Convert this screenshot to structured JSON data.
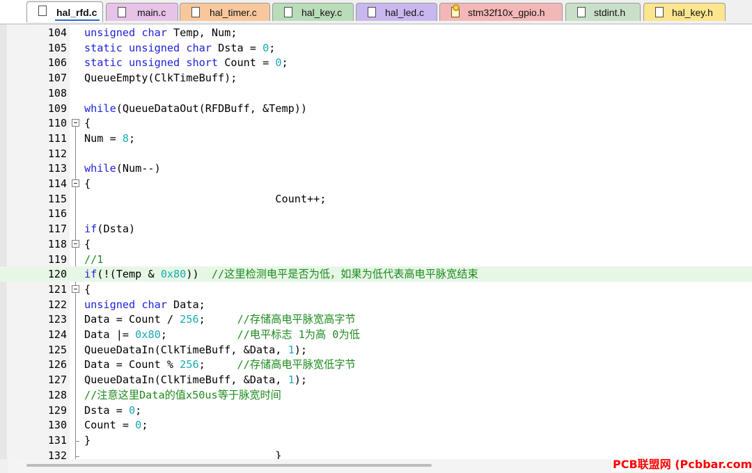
{
  "tabs": [
    {
      "label": "hal_rfd.c",
      "active": true,
      "color": "#ffffff"
    },
    {
      "label": "main.c",
      "active": false,
      "color": "#e7c3e7"
    },
    {
      "label": "hal_timer.c",
      "active": false,
      "color": "#f8c89c"
    },
    {
      "label": "hal_key.c",
      "active": false,
      "color": "#b9dcb9"
    },
    {
      "label": "hal_led.c",
      "active": false,
      "color": "#c9b8ef"
    },
    {
      "label": "stm32f10x_gpio.h",
      "active": false,
      "color": "#f4b7b7"
    },
    {
      "label": "stdint.h",
      "active": false,
      "color": "#c9dfc9"
    },
    {
      "label": "hal_key.h",
      "active": false,
      "color": "#fbe58e"
    }
  ],
  "editor": {
    "highlighted_line": "120",
    "lines": [
      {
        "n": "104",
        "code": "unsigned char Temp, Num;"
      },
      {
        "n": "105",
        "code": "static unsigned char Dsta = 0;"
      },
      {
        "n": "106",
        "code": "static unsigned short Count = 0;"
      },
      {
        "n": "107",
        "code": "QueueEmpty(ClkTimeBuff);"
      },
      {
        "n": "108",
        "code": ""
      },
      {
        "n": "109",
        "code": "while(QueueDataOut(RFDBuff, &Temp))"
      },
      {
        "n": "110",
        "code": "{"
      },
      {
        "n": "111",
        "code": "Num = 8;"
      },
      {
        "n": "112",
        "code": ""
      },
      {
        "n": "113",
        "code": "while(Num--)"
      },
      {
        "n": "114",
        "code": "{"
      },
      {
        "n": "115",
        "code": "                              Count++;"
      },
      {
        "n": "116",
        "code": ""
      },
      {
        "n": "117",
        "code": "if(Dsta)"
      },
      {
        "n": "118",
        "code": "{"
      },
      {
        "n": "119",
        "code": "//1"
      },
      {
        "n": "120",
        "code": "if(!(Temp & 0x80))  //这里检测电平是否为低，如果为低代表高电平脉宽结束"
      },
      {
        "n": "121",
        "code": "{"
      },
      {
        "n": "122",
        "code": "unsigned char Data;"
      },
      {
        "n": "123",
        "code": "Data = Count / 256;     //存储高电平脉宽高字节"
      },
      {
        "n": "124",
        "code": "Data |= 0x80;           //电平标志 1为高 0为低"
      },
      {
        "n": "125",
        "code": "QueueDataIn(ClkTimeBuff, &Data, 1);"
      },
      {
        "n": "126",
        "code": "Data = Count % 256;     //存储高电平脉宽低字节"
      },
      {
        "n": "127",
        "code": "QueueDataIn(ClkTimeBuff, &Data, 1);"
      },
      {
        "n": "128",
        "code": "//注意这里Data的值x50us等于脉宽时间"
      },
      {
        "n": "129",
        "code": "Dsta = 0;"
      },
      {
        "n": "130",
        "code": "Count = 0;"
      },
      {
        "n": "131",
        "code": "}"
      },
      {
        "n": "132",
        "code": "                              }"
      }
    ]
  },
  "watermark": "PCB联盟网 (Pcbbar.com)",
  "colors": {
    "keyword": "#1e22d8",
    "number": "#19a9b4",
    "comment": "#1e8a1e",
    "highlight": "#e6f7e6"
  }
}
